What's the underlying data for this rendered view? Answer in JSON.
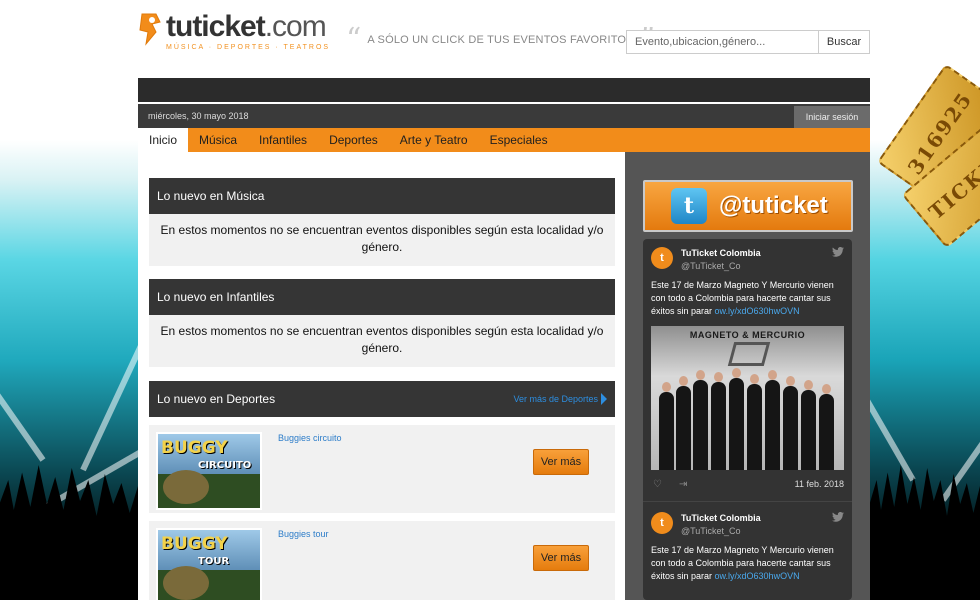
{
  "header": {
    "logo_name": "tuticket",
    "logo_tld": ".com",
    "logo_subtitle": "MÚSICA · DEPORTES · TEATROS",
    "tagline": "A SÓLO UN CLICK DE TUS EVENTOS FAVORITOS",
    "quote_open": "“",
    "quote_close": "”",
    "search_placeholder": "Evento,ubicacion,género...",
    "search_button": "Buscar"
  },
  "topbar": {
    "date": "miércoles, 30 mayo 2018",
    "login": "Iniciar sesión"
  },
  "nav": {
    "items": [
      {
        "label": "Inicio"
      },
      {
        "label": "Música"
      },
      {
        "label": "Infantiles"
      },
      {
        "label": "Deportes"
      },
      {
        "label": "Arte y Teatro"
      },
      {
        "label": "Especiales"
      }
    ],
    "active": "Inicio"
  },
  "sections": {
    "musica": {
      "title": "Lo nuevo en Música",
      "empty_message": "En estos momentos no se encuentran eventos disponibles según esta localidad y/o género."
    },
    "infantiles": {
      "title": "Lo nuevo en Infantiles",
      "empty_message": "En estos momentos no se encuentran eventos disponibles según esta localidad y/o género."
    },
    "deportes": {
      "title": "Lo nuevo en Deportes",
      "more_link": "Ver más de Deportes",
      "events": [
        {
          "title": "Buggies circuito",
          "thumb_word": "BUGGY",
          "thumb_sub": "CIRCUITO",
          "button": "Ver más"
        },
        {
          "title": "Buggies tour",
          "thumb_word": "BUGGY",
          "thumb_sub": "TOUR",
          "button": "Ver más"
        }
      ]
    }
  },
  "twitter": {
    "banner_handle": "@tuticket",
    "bird_glyph": "t",
    "tweets": [
      {
        "name": "TuTicket Colombia",
        "user": "@TuTicket_Co",
        "text": "Este 17 de Marzo Magneto Y Mercurio vienen con todo a Colombia para hacerte cantar sus éxitos sin parar ",
        "link": "ow.ly/xdO630hwOVN",
        "image_title": "MAGNETO & MERCURIO",
        "date": "11 feb. 2018"
      },
      {
        "name": "TuTicket Colombia",
        "user": "@TuTicket_Co",
        "text": "Este 17 de Marzo Magneto Y Mercurio vienen con todo a Colombia para hacerte cantar sus éxitos sin parar ",
        "link": "ow.ly/xdO630hwOVN"
      }
    ]
  },
  "decor": {
    "ticket_text": "TICKET",
    "ticket_number": "316925"
  },
  "colors": {
    "brand_orange": "#f28c1a",
    "dark_header": "#353535",
    "link_blue": "#2d8ee0"
  }
}
